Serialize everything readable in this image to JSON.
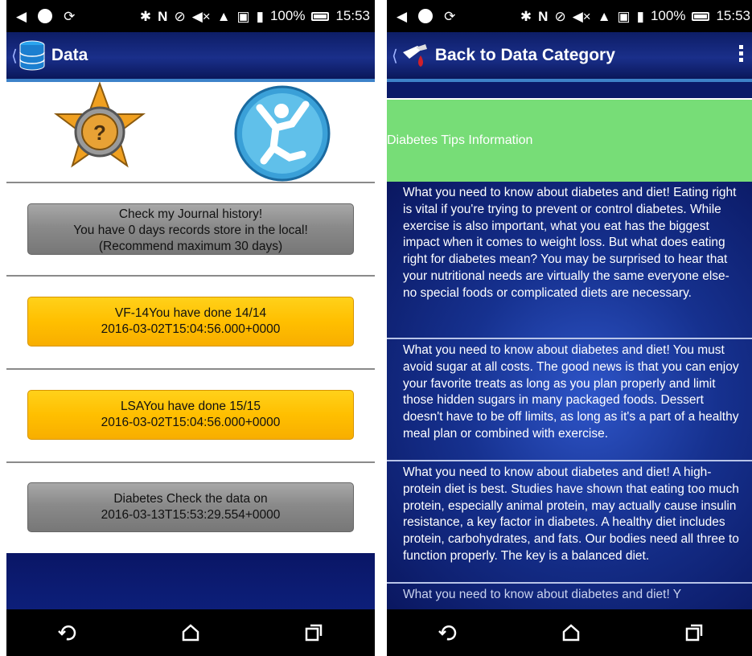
{
  "status_bar": {
    "battery": "100%",
    "time": "15:53"
  },
  "left_screen": {
    "title": "Data",
    "buttons": [
      {
        "lines": [
          "Check my Journal history!",
          "You have 0 days records store in the local!",
          "(Recommend maximum 30 days)"
        ],
        "style": "gray"
      },
      {
        "lines": [
          "VF-14You have done 14/14",
          "2016-03-02T15:04:56.000+0000"
        ],
        "style": "orange"
      },
      {
        "lines": [
          "LSAYou have done 15/15",
          "2016-03-02T15:04:56.000+0000"
        ],
        "style": "orange"
      },
      {
        "lines": [
          "Diabetes Check the data on",
          "2016-03-13T15:53:29.554+0000"
        ],
        "style": "gray"
      }
    ]
  },
  "right_screen": {
    "title": "Back to Data Category",
    "header_text": "Diabetes Tips Information",
    "tips": [
      "What you need to know about diabetes and diet! Eating right is vital if you're trying to prevent or control diabetes. While exercise is also important, what you eat has the biggest impact when it comes to weight loss. But what does eating right for diabetes mean? You may be surprised to hear that your nutritional needs are virtually the same everyone else- no special foods or complicated diets are necessary.",
      "What you need to know about diabetes and diet! You must avoid sugar at all costs. The good news is that you can enjoy your favorite treats as long as you plan properly and limit those hidden sugars in many packaged foods. Dessert doesn't have to be off limits, as long as it's a part of a healthy meal plan or combined with exercise.",
      "What you need to know about diabetes and diet! A high-protein diet is best. Studies have shown that eating too much protein, especially animal protein, may actually cause insulin resistance, a key factor in diabetes. A healthy diet includes protein, carbohydrates, and fats. Our bodies need all three to function properly. The key is a balanced diet.",
      "What you need to know about diabetes and diet! Y"
    ]
  },
  "colors": {
    "actionbar": "#1a2f8a",
    "green_panel": "#77dd77",
    "orange_button": "#ffbf00",
    "gray_button": "#8a8a8a"
  },
  "icons": [
    "back-icon",
    "home-icon",
    "recents-icon",
    "database-icon",
    "dropper-icon",
    "bluetooth-icon",
    "wifi-icon",
    "battery-icon"
  ]
}
